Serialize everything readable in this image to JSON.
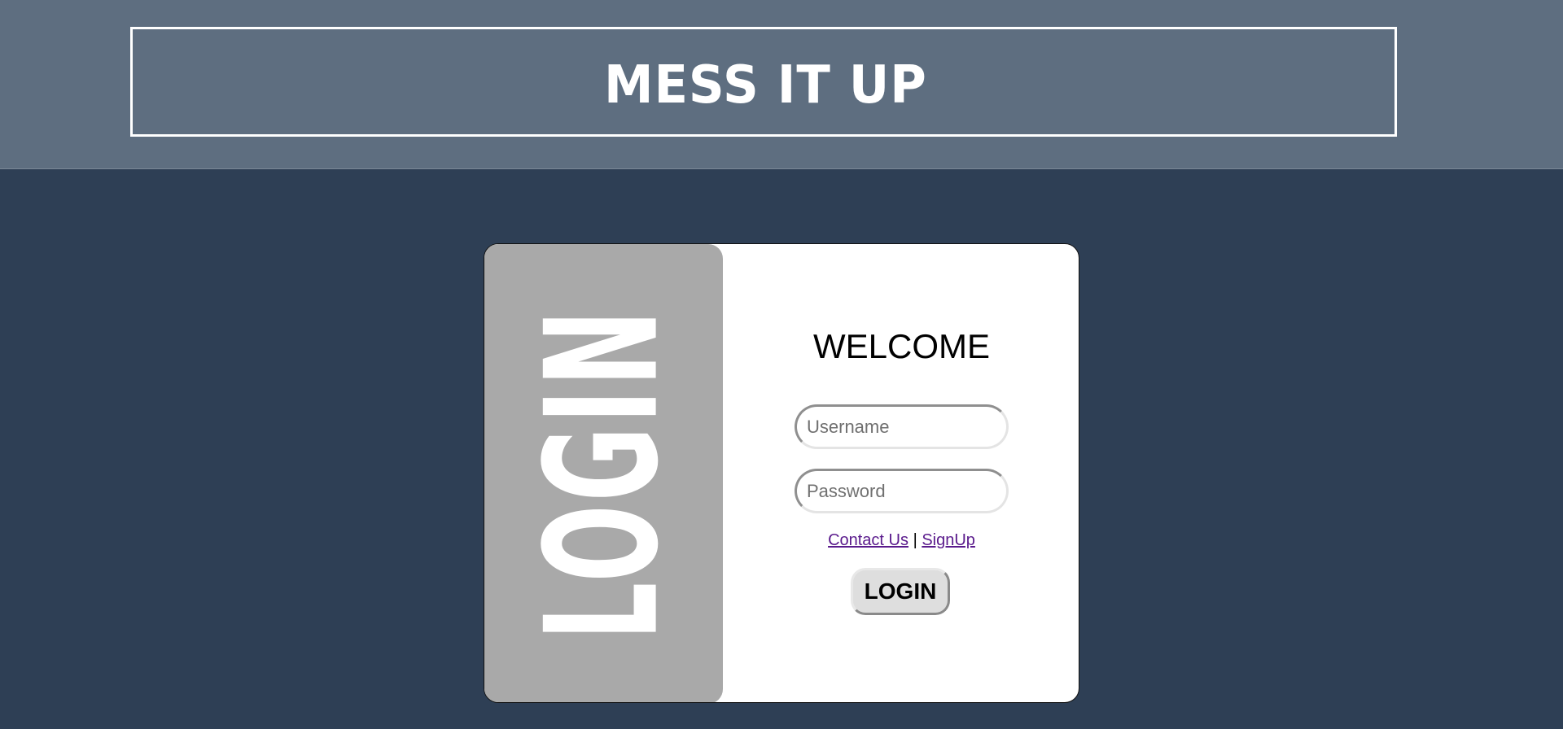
{
  "header": {
    "title": "MESS IT UP"
  },
  "login_card": {
    "side_label": "LOGIN",
    "welcome": "WELCOME",
    "username_placeholder": "Username",
    "username_value": "",
    "password_placeholder": "Password",
    "password_value": "",
    "links": {
      "contact": "Contact Us",
      "separator": "|",
      "signup": "SignUp"
    },
    "login_button": "LOGIN"
  },
  "colors": {
    "page_background": "#2e3f55",
    "header_background": "#5e6e80",
    "side_panel": "#a9a9a9",
    "card_background": "#ffffff",
    "link": "#5a1a8c",
    "button_background": "#dedede"
  }
}
